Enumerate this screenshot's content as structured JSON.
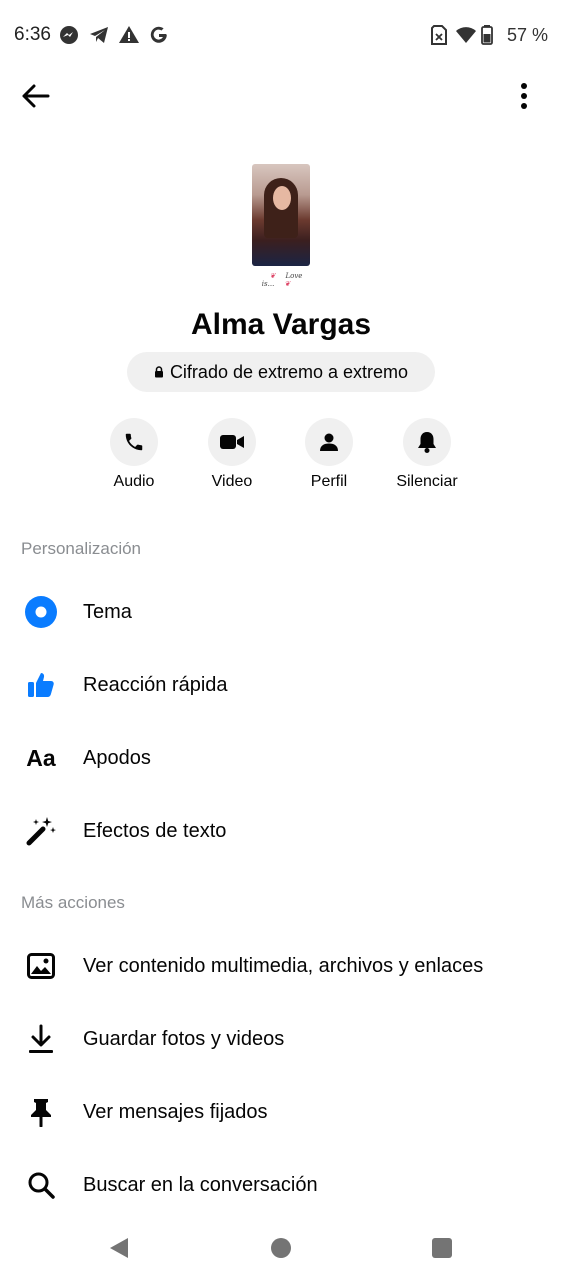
{
  "status_bar": {
    "time": "6:36",
    "left_icons": [
      "messenger-icon",
      "telegram-icon",
      "warning-icon",
      "google-icon"
    ],
    "right_icons": [
      "sim-off-icon",
      "wifi-icon",
      "battery-icon"
    ],
    "battery": "57 %"
  },
  "header": {
    "back_icon": "arrow-left-icon",
    "more_icon": "more-vertical-icon"
  },
  "profile": {
    "name": "Alma Vargas",
    "photo_caption": "Love is...",
    "encryption_label": "Cifrado de extremo a extremo"
  },
  "actions": [
    {
      "label": "Audio",
      "icon": "phone-icon"
    },
    {
      "label": "Video",
      "icon": "video-camera-icon"
    },
    {
      "label": "Perfil",
      "icon": "person-icon"
    },
    {
      "label": "Silenciar",
      "icon": "bell-icon"
    }
  ],
  "personalization": {
    "title": "Personalización",
    "items": [
      {
        "label": "Tema",
        "icon": "theme-icon"
      },
      {
        "label": "Reacción rápida",
        "icon": "thumbs-up-icon"
      },
      {
        "label": "Apodos",
        "icon": "nickname-icon",
        "icon_text": "Aa"
      },
      {
        "label": "Efectos de texto",
        "icon": "magic-wand-icon"
      }
    ]
  },
  "more_actions": {
    "title": "Más acciones",
    "items": [
      {
        "label": "Ver contenido multimedia, archivos y enlaces",
        "icon": "image-icon"
      },
      {
        "label": "Guardar fotos y videos",
        "icon": "download-icon"
      },
      {
        "label": "Ver mensajes fijados",
        "icon": "pin-icon"
      },
      {
        "label": "Buscar en la conversación",
        "icon": "search-icon"
      }
    ]
  },
  "colors": {
    "accent": "#0a7cff",
    "pill_bg": "#f0f0f0",
    "section_title": "#8a8d91"
  }
}
